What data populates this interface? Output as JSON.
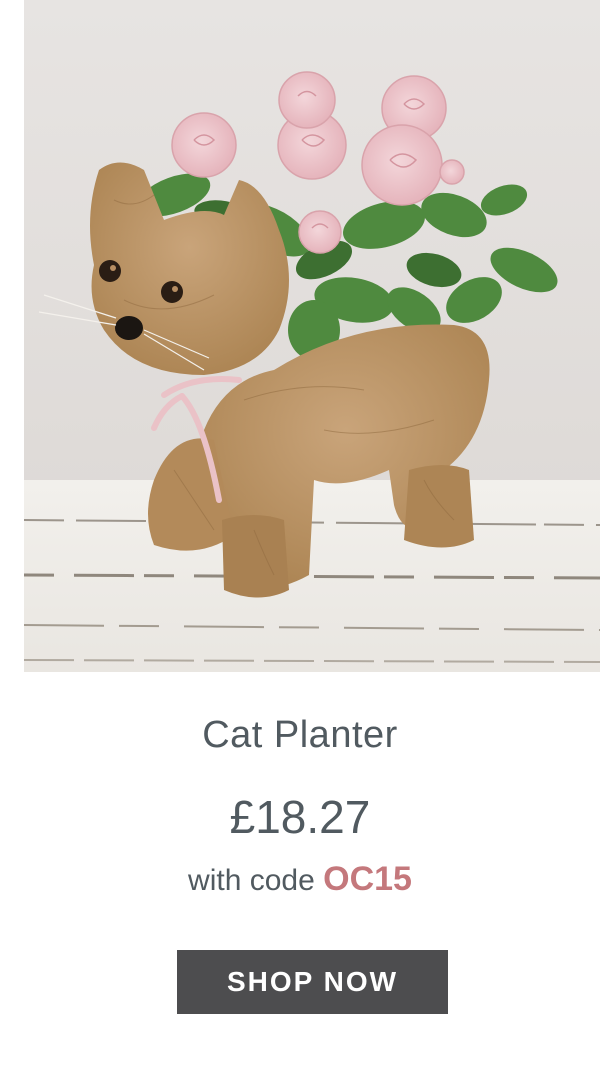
{
  "product": {
    "title": "Cat Planter",
    "price": "£18.27",
    "promo_prefix": "with code",
    "promo_code": "OC15"
  },
  "cta": {
    "label": "SHOP NOW"
  },
  "colors": {
    "text": "#515a60",
    "promo_code": "#c4787c",
    "button_bg": "#4d4d4f",
    "button_text": "#ffffff"
  }
}
